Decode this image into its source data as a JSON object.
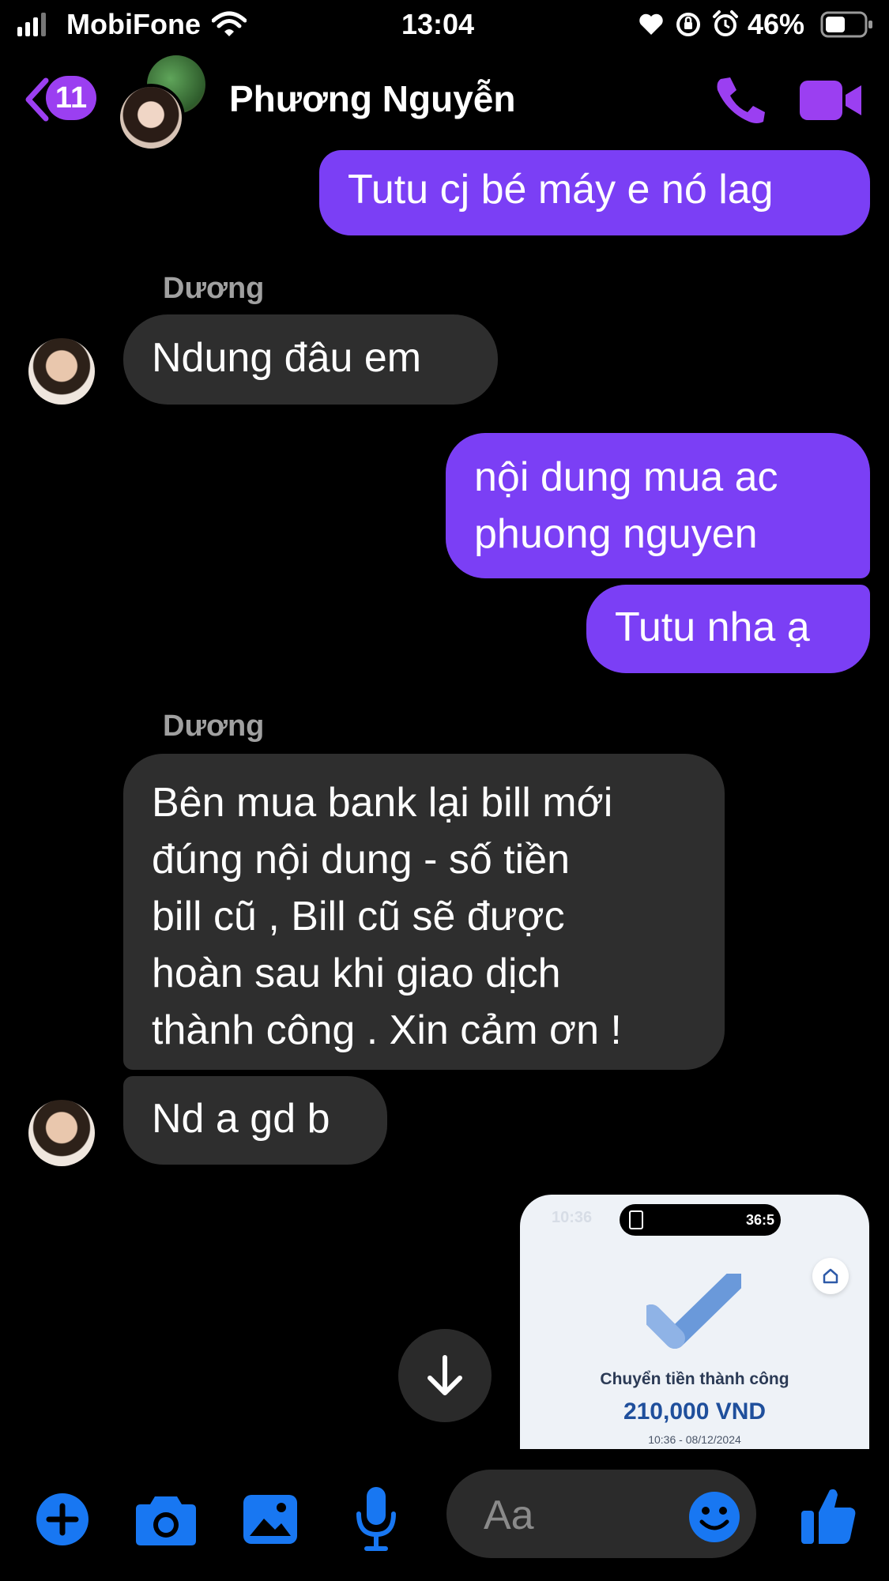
{
  "status_bar": {
    "carrier": "MobiFone",
    "time": "13:04",
    "battery": "46%"
  },
  "header": {
    "back_count": "11",
    "contact_name": "Phương Nguyễn"
  },
  "messages": [
    {
      "side": "out",
      "text": "Tutu cj bé máy e nó lag"
    },
    {
      "side": "in",
      "sender": "Dương",
      "text": "Ndung đâu em"
    },
    {
      "side": "out",
      "lines": [
        "nội dung mua ac",
        "phuong nguyen"
      ]
    },
    {
      "side": "out",
      "text": "Tutu nha ạ"
    },
    {
      "side": "in",
      "sender": "Dương",
      "lines": [
        "Bên mua bank lại bill mới",
        "đúng nội dung - số tiền",
        "bill cũ , Bill cũ sẽ được",
        "hoàn sau khi giao dịch",
        "thành công . Xin cảm ơn !"
      ]
    },
    {
      "side": "in",
      "text": "Nd a gd b"
    }
  ],
  "image_message": {
    "inner_time": "10:36",
    "inner_timer": "36:5",
    "title": "Chuyển tiền thành công",
    "amount": "210,000 VND",
    "datetime": "10:36 - 08/12/2024"
  },
  "composer": {
    "placeholder": "Aa"
  },
  "colors": {
    "accent": "#9b3ff1",
    "outgoing_bubble": "#7b3ff5",
    "incoming_bubble": "#2e2e2e",
    "icon_blue": "#1877f2"
  },
  "icons": [
    "signal-icon",
    "wifi-icon",
    "heart-icon",
    "rotation-lock-icon",
    "alarm-icon",
    "battery-icon",
    "back-chevron-icon",
    "phone-icon",
    "video-icon",
    "arrow-down-icon",
    "plus-icon",
    "camera-icon",
    "gallery-icon",
    "mic-icon",
    "emoji-icon",
    "thumbs-up-icon"
  ]
}
